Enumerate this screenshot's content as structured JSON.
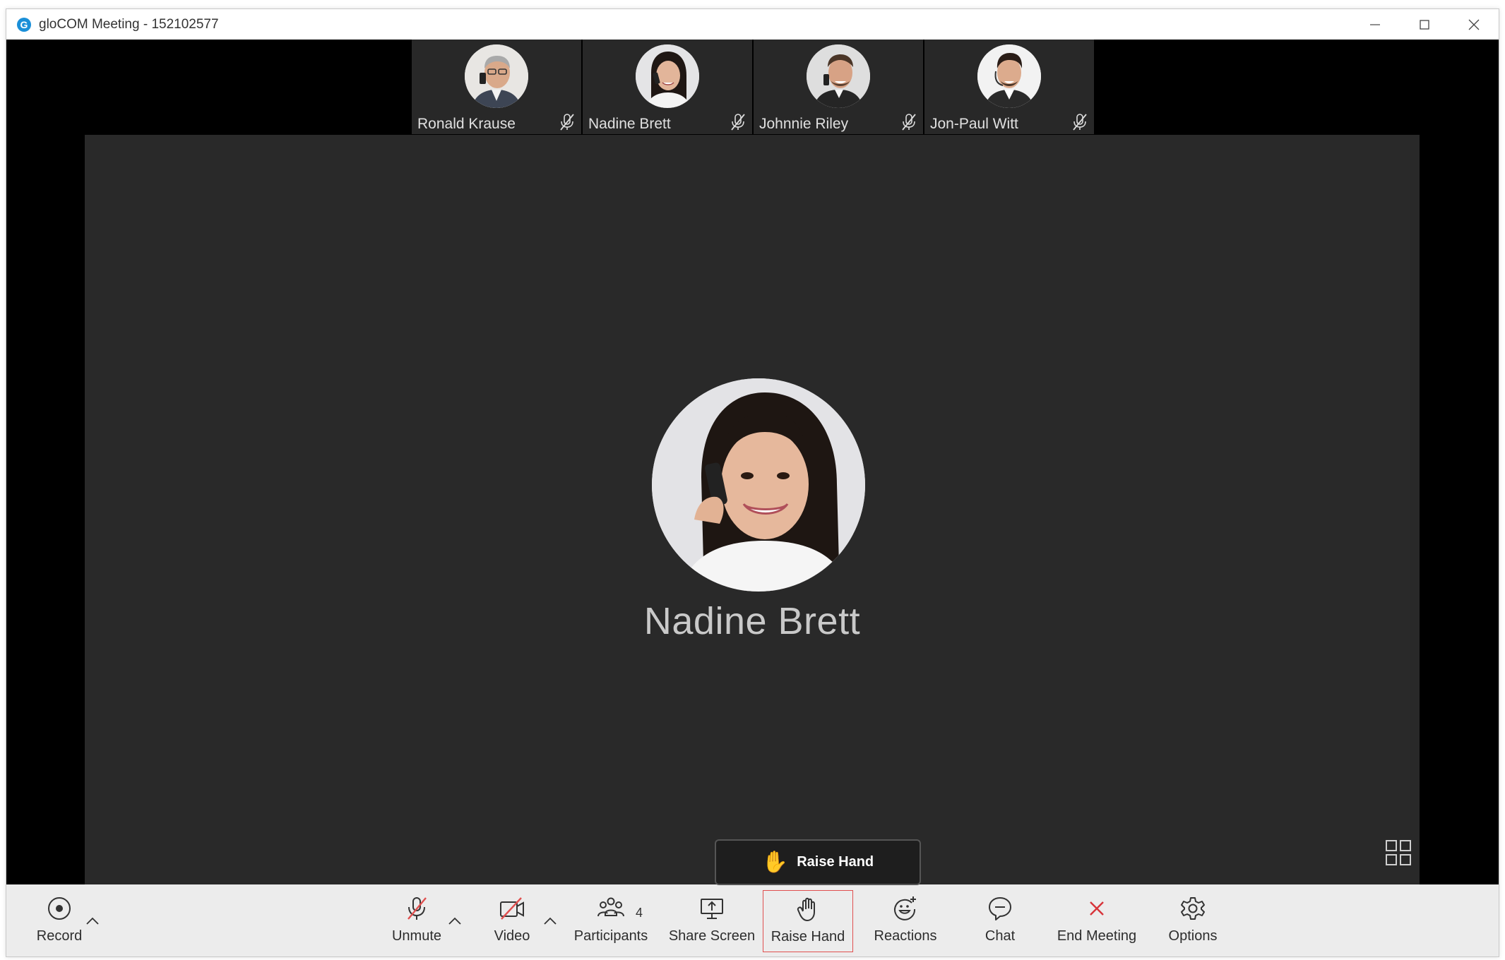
{
  "window": {
    "title": "gloCOM Meeting - 152102577",
    "app_icon_letter": "G",
    "controls": [
      "minimize-icon",
      "maximize-icon",
      "close-icon"
    ]
  },
  "participants_strip": [
    {
      "name": "Ronald Krause",
      "muted": true,
      "icon": "mic-off-icon"
    },
    {
      "name": "Nadine Brett",
      "muted": true,
      "icon": "mic-off-icon"
    },
    {
      "name": "Johnnie Riley",
      "muted": true,
      "icon": "mic-off-icon"
    },
    {
      "name": "Jon-Paul Witt",
      "muted": true,
      "icon": "mic-off-icon"
    }
  ],
  "main_speaker": {
    "name": "Nadine Brett"
  },
  "toast": {
    "label": "Raise Hand",
    "icon": "raised-hand-emoji"
  },
  "toolbar": {
    "record": "Record",
    "unmute": "Unmute",
    "video": "Video",
    "participants": "Participants",
    "participants_count": "4",
    "share_screen": "Share Screen",
    "raise_hand": "Raise Hand",
    "reactions": "Reactions",
    "chat": "Chat",
    "end_meeting": "End Meeting",
    "options": "Options"
  },
  "colors": {
    "accent_red": "#e0504f",
    "end_meeting_red": "#d8343a",
    "toolbar_bg": "#ececec",
    "stage_bg": "#000000",
    "tile_bg": "#282828",
    "brand_blue": "#1a8fd8"
  }
}
